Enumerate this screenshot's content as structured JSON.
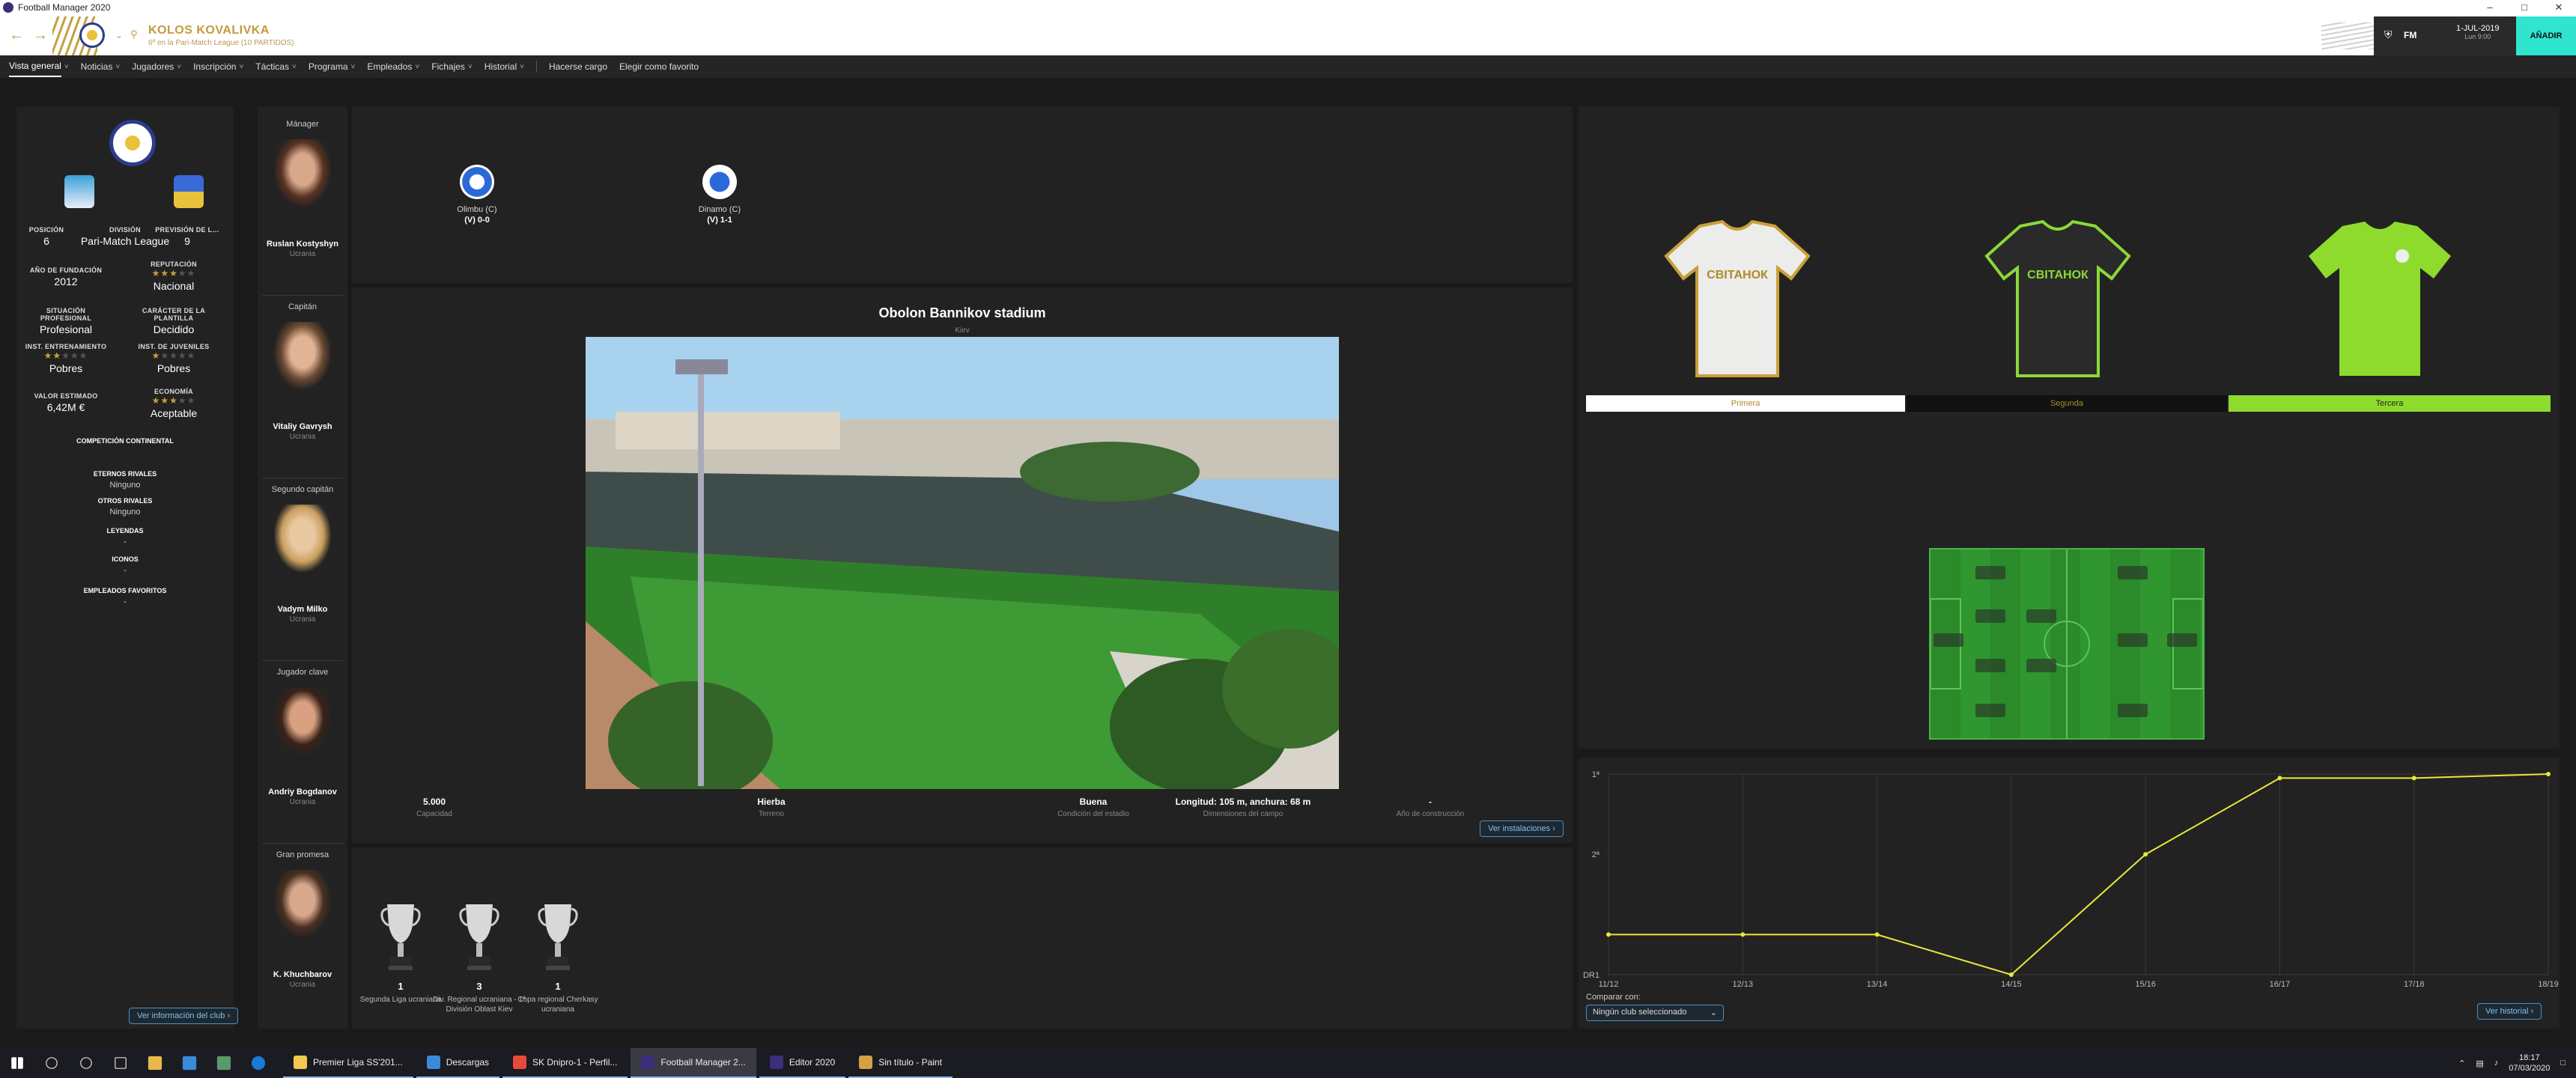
{
  "window": {
    "title": "Football Manager 2020"
  },
  "header": {
    "club_name": "KOLOS KOVALIVKA",
    "club_sub": "6º en la Pari-Match League (10 PARTIDOS)",
    "game_label": "FM",
    "date_line1": "1-JUL-2019",
    "date_line2": "Lun 9:00",
    "continue_label": "AÑADIR"
  },
  "nav": {
    "items": [
      "Vista general",
      "Noticias",
      "Jugadores",
      "Inscripción",
      "Tácticas",
      "Programa",
      "Empleados",
      "Fichajes",
      "Historial"
    ],
    "extra": [
      "Hacerse cargo",
      "Elegir como favorito"
    ]
  },
  "club": {
    "position_label": "POSICIÓN",
    "position": "6",
    "division_label": "DIVISIÓN",
    "division": "Pari-Match League",
    "forecast_label": "PREVISIÓN DE L…",
    "forecast": "9",
    "founded_label": "AÑO DE FUNDACIÓN",
    "founded": "2012",
    "reputation_label": "REPUTACIÓN",
    "reputation": "Nacional",
    "pro_label": "SITUACIÓN PROFESIONAL",
    "pro": "Profesional",
    "squad_label": "CARÁCTER DE LA PLANTILLA",
    "squad": "Decidido",
    "training_label": "INST. ENTRENAMIENTO",
    "training": "Pobres",
    "youth_label": "INST. DE JUVENILES",
    "youth": "Pobres",
    "value_label": "VALOR ESTIMADO",
    "value": "6,42M €",
    "economy_label": "ECONOMÍA",
    "economy": "Aceptable",
    "continental_label": "COMPETICIÓN CONTINENTAL",
    "eternal_label": "ETERNOS RIVALES",
    "eternal": "Ninguno",
    "other_label": "OTROS RIVALES",
    "other": "Ninguno",
    "legends_label": "LEYENDAS",
    "legends": "-",
    "icons_label": "ICONOS",
    "icons": "-",
    "fav_label": "EMPLEADOS FAVORITOS",
    "fav": "-",
    "info_button": "Ver información del club"
  },
  "staff": [
    {
      "role": "Mánager",
      "name": "Ruslan Kostyshyn",
      "nat": "Ucrania"
    },
    {
      "role": "Capitán",
      "name": "Vitaliy Gavrysh",
      "nat": "Ucrania"
    },
    {
      "role": "Segundo capitán",
      "name": "Vadym Milko",
      "nat": "Ucrania"
    },
    {
      "role": "Jugador clave",
      "name": "Andriy Bogdanov",
      "nat": "Ucrania"
    },
    {
      "role": "Gran promesa",
      "name": "K. Khuchbarov",
      "nat": "Ucrania"
    }
  ],
  "results": [
    {
      "team": "Olimbu (C)",
      "score": "(V) 0-0"
    },
    {
      "team": "Dinamo (C)",
      "score": "(V) 1-1"
    }
  ],
  "stadium": {
    "name": "Obolon Bannikov stadium",
    "city": "Kiev",
    "capacity": "5.000",
    "capacity_label": "Capacidad",
    "surface": "Hierba",
    "surface_label": "Terreno",
    "condition": "Buena",
    "condition_label": "Condición del estadio",
    "dimensions": "Longitud: 105 m, anchura: 68 m",
    "dimensions_label": "Dimensiones del campo",
    "year": "-",
    "year_label": "Año de construcción",
    "button": "Ver instalaciones"
  },
  "trophies": [
    {
      "count": "1",
      "title": "Segunda Liga ucraniana"
    },
    {
      "count": "3",
      "title": "Div. Regional ucraniana - 1ª División Oblast Kiev"
    },
    {
      "count": "1",
      "title": "Copa regional Cherkasy ucraniana"
    }
  ],
  "kits": {
    "labels": [
      "Primera",
      "Segunda",
      "Tercera"
    ],
    "sponsor": "СВІТАНОК"
  },
  "history": {
    "compare_label": "Comparar con:",
    "compare_value": "Ningún club seleccionado",
    "button": "Ver historial"
  },
  "chart_data": {
    "type": "line",
    "categories": [
      "11/12",
      "12/13",
      "13/14",
      "14/15",
      "15/16",
      "16/17",
      "17/18",
      "18/19"
    ],
    "y_tick_labels": [
      "1ª",
      "2ª",
      "DR1"
    ],
    "series": [
      {
        "values": [
          3,
          3,
          3,
          3.5,
          2,
          1.05,
          1.05,
          1
        ]
      }
    ],
    "y_range": [
      1,
      3.5
    ],
    "grid": true,
    "line_color": "#e8e83a"
  },
  "taskbar": {
    "apps": [
      "Premier Liga SS'201...",
      "Descargas",
      "SK Dnipro-1 - Perfil...",
      "Football Manager 2...",
      "Editor 2020",
      "Sin título - Paint"
    ],
    "time": "18:17",
    "date": "07/03/2020"
  }
}
